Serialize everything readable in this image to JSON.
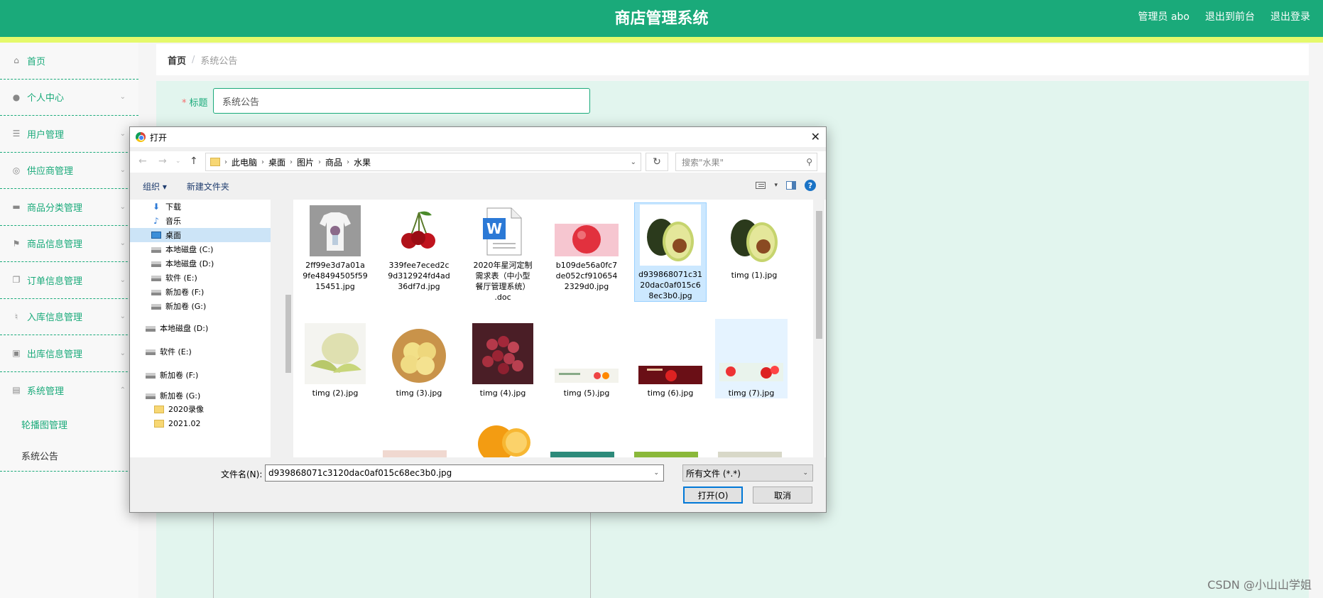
{
  "header": {
    "title": "商店管理系统",
    "admin_label": "管理员 abo",
    "front_link": "退出到前台",
    "logout_link": "退出登录"
  },
  "sidebar": {
    "items": [
      {
        "label": "首页",
        "icon": "home-icon"
      },
      {
        "label": "个人中心",
        "icon": "user-icon"
      },
      {
        "label": "用户管理",
        "icon": "list-icon"
      },
      {
        "label": "供应商管理",
        "icon": "supplier-icon"
      },
      {
        "label": "商品分类管理",
        "icon": "category-icon"
      },
      {
        "label": "商品信息管理",
        "icon": "flag-icon"
      },
      {
        "label": "订单信息管理",
        "icon": "order-icon"
      },
      {
        "label": "入库信息管理",
        "icon": "mic-icon"
      },
      {
        "label": "出库信息管理",
        "icon": "clipboard-icon"
      },
      {
        "label": "系统管理",
        "icon": "system-icon"
      }
    ],
    "sub_items": [
      {
        "label": "轮播图管理"
      },
      {
        "label": "系统公告"
      }
    ]
  },
  "breadcrumb": {
    "home": "首页",
    "separator": "/",
    "current": "系统公告"
  },
  "form": {
    "title_label": "标题",
    "required_mark": "*",
    "title_value": "系统公告"
  },
  "dialog": {
    "title": "打开",
    "path": [
      "此电脑",
      "桌面",
      "图片",
      "商品",
      "水果"
    ],
    "search_placeholder": "搜索\"水果\"",
    "toolbar": {
      "organize": "组织 ▾",
      "new_folder": "新建文件夹"
    },
    "nav_items": [
      {
        "label": "下载",
        "icon": "download-icon"
      },
      {
        "label": "音乐",
        "icon": "music-icon"
      },
      {
        "label": "桌面",
        "icon": "desktop-icon"
      },
      {
        "label": "本地磁盘 (C:)",
        "icon": "drive-icon"
      },
      {
        "label": "本地磁盘 (D:)",
        "icon": "drive-icon"
      },
      {
        "label": "软件 (E:)",
        "icon": "drive-icon"
      },
      {
        "label": "新加卷 (F:)",
        "icon": "drive-icon"
      },
      {
        "label": "新加卷 (G:)",
        "icon": "drive-icon"
      },
      {
        "label": "本地磁盘 (D:)",
        "icon": "drive-icon"
      },
      {
        "label": "软件 (E:)",
        "icon": "drive-icon"
      },
      {
        "label": "新加卷 (F:)",
        "icon": "drive-icon"
      },
      {
        "label": "新加卷 (G:)",
        "icon": "drive-icon"
      },
      {
        "label": "2020录像",
        "icon": "folder-icon"
      },
      {
        "label": "2021.02",
        "icon": "folder-icon"
      }
    ],
    "files": [
      {
        "name": "2ff99e3d7a01a9fe48494505f5915451.jpg",
        "lines": [
          "2ff99e3d7a01a",
          "9fe48494505f59",
          "15451.jpg"
        ]
      },
      {
        "name": "339fee7eced2c9d312924fd4ad36df7d.jpg",
        "lines": [
          "339fee7eced2c",
          "9d312924fd4ad",
          "36df7d.jpg"
        ]
      },
      {
        "name": "2020年星河定制需求表（中小型餐厅管理系统）.doc",
        "lines": [
          "2020年星河定制",
          "需求表（中小型",
          "餐厅管理系统）",
          ".doc"
        ]
      },
      {
        "name": "b109de56a0fc7de052cf9106542329d0.jpg",
        "lines": [
          "b109de56a0fc7",
          "de052cf910654",
          "2329d0.jpg"
        ]
      },
      {
        "name": "d939868071c3120dac0af015c68ec3b0.jpg",
        "lines": [
          "d939868071c31",
          "20dac0af015c6",
          "8ec3b0.jpg"
        ]
      },
      {
        "name": "timg (1).jpg",
        "lines": [
          "timg (1).jpg"
        ]
      },
      {
        "name": "timg (2).jpg",
        "lines": [
          "timg (2).jpg"
        ]
      },
      {
        "name": "timg (3).jpg",
        "lines": [
          "timg (3).jpg"
        ]
      },
      {
        "name": "timg (4).jpg",
        "lines": [
          "timg (4).jpg"
        ]
      },
      {
        "name": "timg (5).jpg",
        "lines": [
          "timg (5).jpg"
        ]
      },
      {
        "name": "timg (6).jpg",
        "lines": [
          "timg (6).jpg"
        ]
      },
      {
        "name": "timg (7).jpg",
        "lines": [
          "timg (7).jpg"
        ]
      }
    ],
    "filename_label": "文件名(N):",
    "filename_value": "d939868071c3120dac0af015c68ec3b0.jpg",
    "filetype": "所有文件 (*.*)",
    "open_button": "打开(O)",
    "cancel_button": "取消"
  },
  "watermark": "CSDN @小山山学姐",
  "colors": {
    "primary": "#1aaa7a",
    "stripe": "#e5f96b",
    "content_bg": "#e2f5ee"
  }
}
